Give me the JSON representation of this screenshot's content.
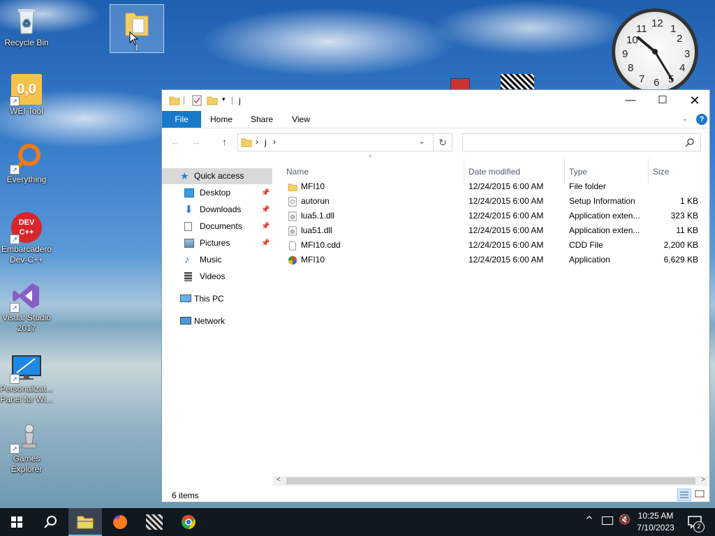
{
  "desktop": {
    "icons": [
      {
        "label": "Recycle Bin"
      },
      {
        "label": "WEI Tool",
        "badge": "0,0"
      },
      {
        "label": "Everything"
      },
      {
        "label": "Embarcadero Dev-C++",
        "badge": "DEV C++"
      },
      {
        "label": "Visual Studio 2017"
      },
      {
        "label": "Personalizat... Panel for Wi..."
      },
      {
        "label": "Games Explorer"
      }
    ],
    "dragged_folder_label": "j",
    "clock_numbers": [
      "12",
      "1",
      "2",
      "3",
      "4",
      "5",
      "6",
      "7",
      "8",
      "9",
      "10",
      "11"
    ]
  },
  "window": {
    "title": "j",
    "ribbon_tabs": [
      "File",
      "Home",
      "Share",
      "View"
    ],
    "address_path": "j",
    "address_sep": "›",
    "search_placeholder": "",
    "nav": {
      "quick_access": "Quick access",
      "items": [
        {
          "label": "Desktop",
          "pinned": true
        },
        {
          "label": "Downloads",
          "pinned": true
        },
        {
          "label": "Documents",
          "pinned": true
        },
        {
          "label": "Pictures",
          "pinned": true
        },
        {
          "label": "Music",
          "pinned": false
        },
        {
          "label": "Videos",
          "pinned": false
        }
      ],
      "this_pc": "This PC",
      "network": "Network"
    },
    "columns": [
      "Name",
      "Date modified",
      "Type",
      "Size"
    ],
    "files": [
      {
        "name": "MFI10",
        "date": "12/24/2015 6:00 AM",
        "type": "File folder",
        "size": "",
        "icon": "folder-icon"
      },
      {
        "name": "autorun",
        "date": "12/24/2015 6:00 AM",
        "type": "Setup Information",
        "size": "1 KB",
        "icon": "settings-file-icon"
      },
      {
        "name": "lua5.1.dll",
        "date": "12/24/2015 6:00 AM",
        "type": "Application exten...",
        "size": "323 KB",
        "icon": "dll-file-icon"
      },
      {
        "name": "lua51.dll",
        "date": "12/24/2015 6:00 AM",
        "type": "Application exten...",
        "size": "11 KB",
        "icon": "dll-file-icon"
      },
      {
        "name": "MFI10.cdd",
        "date": "12/24/2015 6:00 AM",
        "type": "CDD File",
        "size": "2,200 KB",
        "icon": "blank-file-icon"
      },
      {
        "name": "MFI10",
        "date": "12/24/2015 6:00 AM",
        "type": "Application",
        "size": "6,629 KB",
        "icon": "app-icon"
      }
    ],
    "status": "6 items"
  },
  "taskbar": {
    "time": "10:25 AM",
    "date": "7/10/2023",
    "notification_count": "2"
  },
  "colors": {
    "accent": "#1979ca",
    "selection": "#cce8ff",
    "taskbar": "#101820"
  }
}
